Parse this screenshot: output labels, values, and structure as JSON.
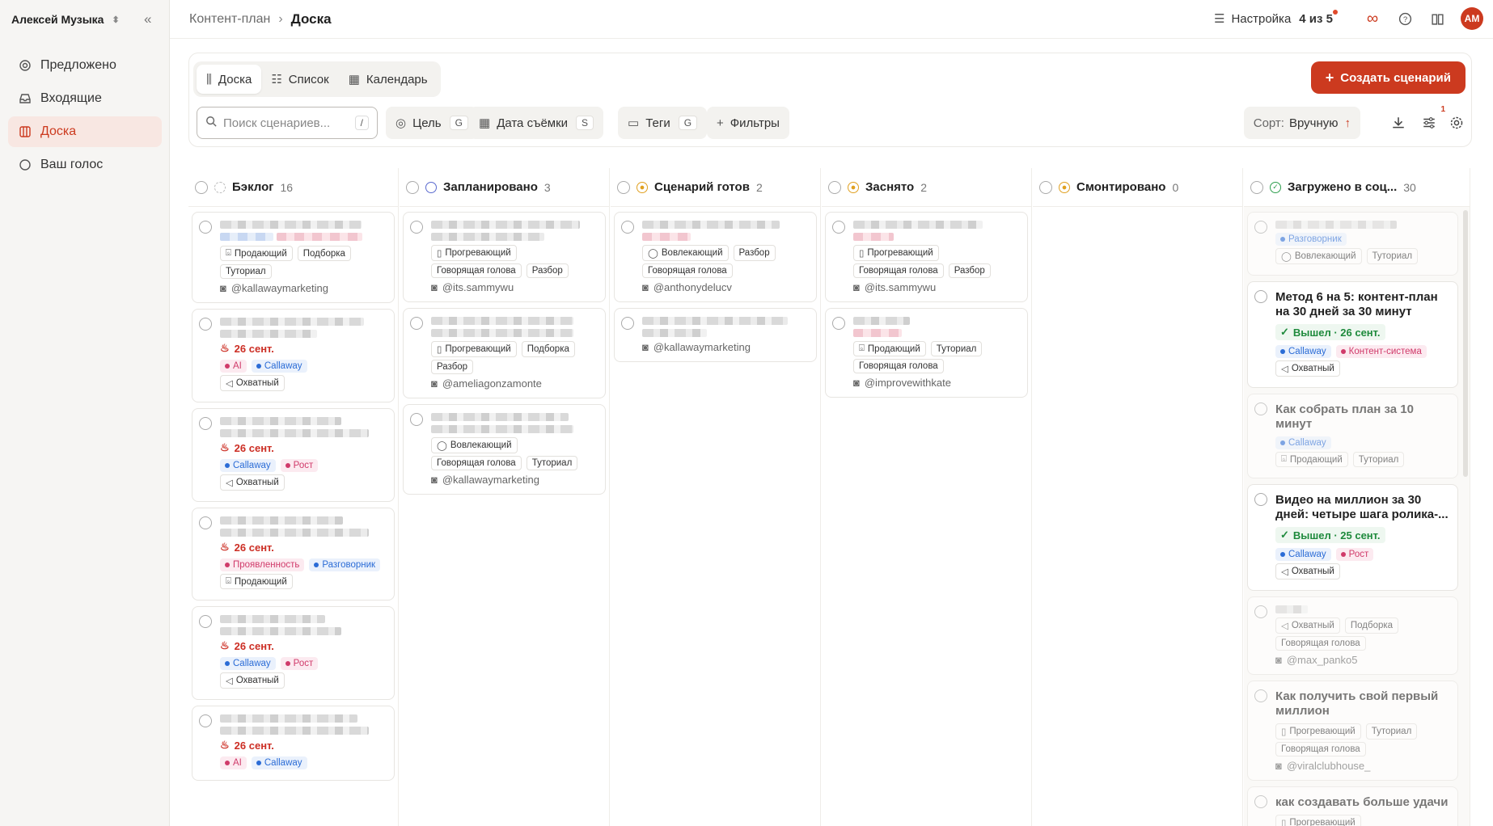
{
  "sidebar": {
    "workspace": "Алексей Музыка",
    "items": [
      {
        "label": "Предложено",
        "icon": "sparkle-icon"
      },
      {
        "label": "Входящие",
        "icon": "inbox-icon"
      },
      {
        "label": "Доска",
        "icon": "board-icon"
      },
      {
        "label": "Ваш голос",
        "icon": "voice-icon"
      }
    ]
  },
  "header": {
    "crumb": "Контент-план",
    "current": "Доска",
    "setup_label": "Настройка",
    "setup_count": "4 из 5",
    "avatar": "АМ"
  },
  "toolbar": {
    "tabs": [
      "Доска",
      "Список",
      "Календарь"
    ],
    "create_label": "Создать сценарий",
    "search_placeholder": "Поиск сценариев...",
    "search_kbd": "/",
    "filters": [
      {
        "label": "Цель",
        "kbd": "G"
      },
      {
        "label": "Дата съёмки",
        "kbd": "S"
      },
      {
        "label": "Теги",
        "kbd": "G"
      },
      {
        "label": "Фильтры",
        "kbd": ""
      }
    ],
    "sort_label": "Сорт:",
    "sort_value": "Вручную",
    "badge": "1"
  },
  "colors": {
    "accent": "#cc3a1f",
    "due": "#cc2e24",
    "done": "#1e8a3c"
  },
  "columns": [
    {
      "name": "Бэклог",
      "count": "16",
      "status_color": "#bbbbbb"
    },
    {
      "name": "Запланировано",
      "count": "3",
      "status_color": "#5a6acf"
    },
    {
      "name": "Сценарий готов",
      "count": "2",
      "status_color": "#e0a020"
    },
    {
      "name": "Заснято",
      "count": "2",
      "status_color": "#e0a020"
    },
    {
      "name": "Смонтировано",
      "count": "0",
      "status_color": "#e0a020"
    },
    {
      "name": "Загружено в соц...",
      "count": "30",
      "status_color": "#2e9e4e"
    }
  ],
  "cards": {
    "c0_0": {
      "chips": [
        "Продающий",
        "Подборка",
        "Туториал"
      ],
      "handle": "@kallawaymarketing"
    },
    "c0_1": {
      "due": "26 сент.",
      "tags": [
        "AI",
        "Callaway"
      ],
      "chips": [
        "Охватный"
      ]
    },
    "c0_2": {
      "due": "26 сент.",
      "tags": [
        "Callaway",
        "Рост"
      ],
      "chips": [
        "Охватный"
      ]
    },
    "c0_3": {
      "due": "26 сент.",
      "tags": [
        "Проявленность",
        "Разговорник"
      ],
      "chips": [
        "Продающий"
      ]
    },
    "c0_4": {
      "due": "26 сент.",
      "tags": [
        "Callaway",
        "Рост"
      ],
      "chips": [
        "Охватный"
      ]
    },
    "c0_5": {
      "due": "26 сент.",
      "tags": [
        "AI",
        "Callaway"
      ]
    },
    "c1_0": {
      "chips": [
        "Прогревающий",
        "Говорящая голова",
        "Разбор"
      ],
      "handle": "@its.sammywu"
    },
    "c1_1": {
      "chips": [
        "Прогревающий",
        "Подборка",
        "Разбор"
      ],
      "handle": "@ameliagonzamonte"
    },
    "c1_2": {
      "chips": [
        "Вовлекающий",
        "Говорящая голова",
        "Туториал"
      ],
      "handle": "@kallawaymarketing"
    },
    "c2_0": {
      "chips": [
        "Вовлекающий",
        "Разбор",
        "Говорящая голова"
      ],
      "handle": "@anthonydelucv"
    },
    "c2_1": {
      "handle": "@kallawaymarketing"
    },
    "c3_0": {
      "chips": [
        "Прогревающий",
        "Говорящая голова",
        "Разбор"
      ],
      "handle": "@its.sammywu"
    },
    "c3_1": {
      "chips": [
        "Продающий",
        "Туториал",
        "Говорящая голова"
      ],
      "handle": "@improvewithkate"
    },
    "c5_0": {
      "tags": [
        "Разговорник"
      ],
      "chips": [
        "Вовлекающий",
        "Туториал"
      ]
    },
    "c5_1": {
      "title": "Метод 6 на 5: контент-план на 30 дней за 30 минут",
      "done": "Вышел · 26 сент.",
      "tags": [
        "Callaway",
        "Контент-система"
      ],
      "chips": [
        "Охватный"
      ]
    },
    "c5_2": {
      "title": "Как собрать план за 10 минут",
      "tags": [
        "Callaway"
      ],
      "chips": [
        "Продающий",
        "Туториал"
      ]
    },
    "c5_3": {
      "title": "Видео на миллион за 30 дней: четыре шага ролика-...",
      "done": "Вышел · 25 сент.",
      "tags": [
        "Callaway",
        "Рост"
      ],
      "chips": [
        "Охватный"
      ]
    },
    "c5_4": {
      "chips": [
        "Охватный",
        "Подборка",
        "Говорящая голова"
      ],
      "handle": "@max_panko5"
    },
    "c5_5": {
      "title": "Как получить свой первый миллион",
      "chips": [
        "Прогревающий",
        "Туториал",
        "Говорящая голова"
      ],
      "handle": "@viralclubhouse_"
    },
    "c5_6": {
      "title": "как создавать больше удачи",
      "chips": [
        "Прогревающий"
      ]
    }
  }
}
